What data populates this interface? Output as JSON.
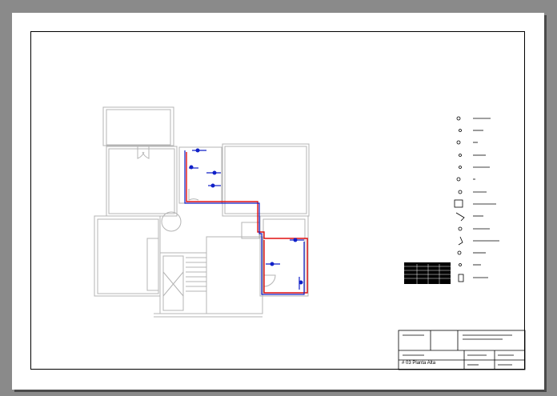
{
  "drawing": {
    "sheet_name": "03 Planta Alta",
    "sheet_prefix": "#"
  },
  "legend": {
    "title": "",
    "items": [
      {
        "icon": "fixture-symbol"
      },
      {
        "icon": "fixture-symbol"
      },
      {
        "icon": "fixture-symbol"
      },
      {
        "icon": "fixture-symbol"
      },
      {
        "icon": "fixture-symbol"
      },
      {
        "icon": "fixture-symbol"
      },
      {
        "icon": "fixture-symbol"
      },
      {
        "icon": "fixture-symbol"
      },
      {
        "icon": "fixture-symbol"
      },
      {
        "icon": "fixture-symbol"
      },
      {
        "icon": "fixture-symbol"
      },
      {
        "icon": "fixture-symbol"
      },
      {
        "icon": "fixture-symbol"
      },
      {
        "icon": "fixture-symbol"
      }
    ]
  },
  "colors": {
    "background": "#8a8a8a",
    "paper": "#ffffff",
    "walls": "#b4b4b4",
    "pipe_red": "#e01010",
    "pipe_blue": "#1020c8",
    "lines": "#000000"
  }
}
